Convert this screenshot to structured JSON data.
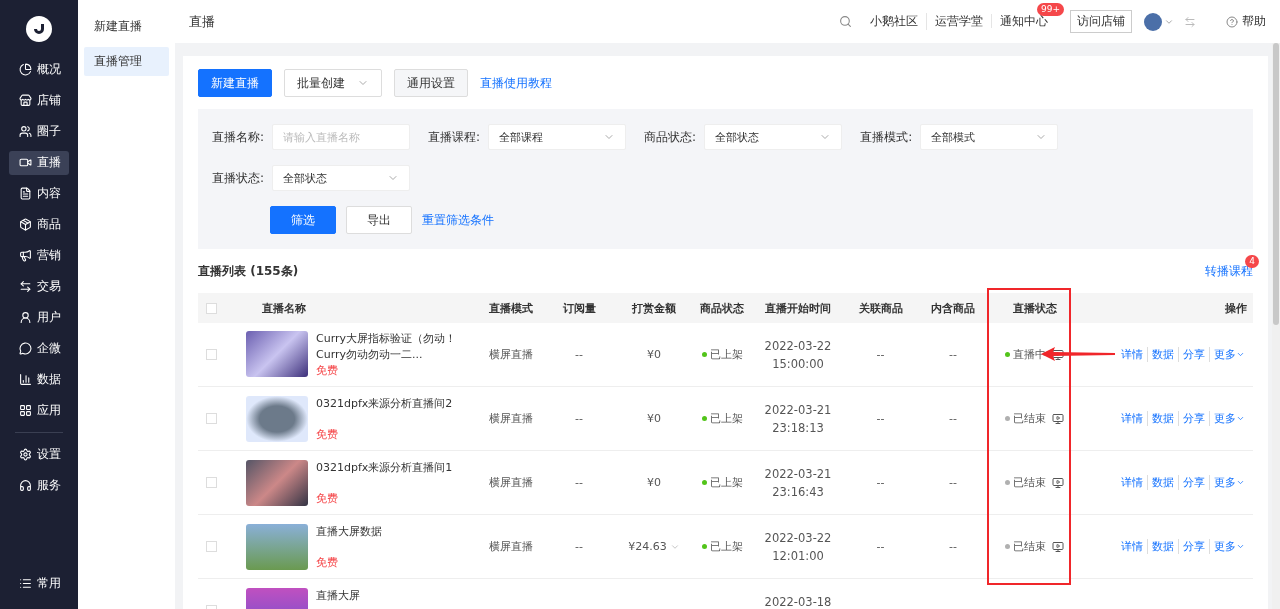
{
  "sidebar": {
    "items": [
      {
        "label": "概况",
        "selected": false
      },
      {
        "label": "店铺",
        "selected": false
      },
      {
        "label": "圈子",
        "selected": false
      },
      {
        "label": "直播",
        "selected": true
      },
      {
        "label": "内容",
        "selected": false
      },
      {
        "label": "商品",
        "selected": false
      },
      {
        "label": "营销",
        "selected": false
      },
      {
        "label": "交易",
        "selected": false
      },
      {
        "label": "用户",
        "selected": false
      },
      {
        "label": "企微",
        "selected": false
      },
      {
        "label": "数据",
        "selected": false
      },
      {
        "label": "应用",
        "selected": false
      }
    ],
    "bottom_items": [
      {
        "label": "设置",
        "selected": false
      },
      {
        "label": "服务",
        "selected": false
      }
    ],
    "footer": {
      "label": "常用"
    }
  },
  "subnav": {
    "items": [
      {
        "label": "新建直播",
        "selected": false
      },
      {
        "label": "直播管理",
        "selected": true
      }
    ]
  },
  "header": {
    "title": "直播",
    "links": [
      "小鹅社区",
      "运营学堂"
    ],
    "notifications": {
      "label": "通知中心",
      "badge": "99+"
    },
    "visit_button": "访问店铺",
    "help": "帮助"
  },
  "toolbar": {
    "primary": "新建直播",
    "batch": "批量创建",
    "settings": "通用设置",
    "tutorial": "直播使用教程"
  },
  "filters": [
    {
      "label": "直播名称:",
      "kind": "input",
      "placeholder": "请输入直播名称"
    },
    {
      "label": "直播课程:",
      "kind": "select",
      "value": "全部课程"
    },
    {
      "label": "商品状态:",
      "kind": "select",
      "value": "全部状态"
    },
    {
      "label": "直播模式:",
      "kind": "select",
      "value": "全部模式"
    },
    {
      "label": "直播状态:",
      "kind": "select",
      "value": "全部状态"
    }
  ],
  "filter_actions": {
    "filter": "筛选",
    "export": "导出",
    "reset": "重置筛选条件"
  },
  "list": {
    "title": "直播列表 (155条)",
    "relay": {
      "label": "转播课程",
      "badge": "4"
    },
    "select_all_checked": false,
    "columns": [
      "直播名称",
      "直播模式",
      "订阅量",
      "打赏金额",
      "商品状态",
      "直播开始时间",
      "关联商品",
      "内含商品",
      "直播状态",
      "操作"
    ],
    "rows": [
      {
        "name": "Curry大屏指标验证（勿动！Curry勿动勿动一二...",
        "price": "免费",
        "mode": "横屏直播",
        "subs": "--",
        "reward": "¥0",
        "reward_more": false,
        "goods": {
          "label": "已上架",
          "color": "#52c41a"
        },
        "date": "2022-03-22",
        "time": "15:00:00",
        "related": "--",
        "contained": "--",
        "status": {
          "label": "直播中",
          "color": "#52c41a"
        },
        "actions": [
          "详情",
          "数据",
          "分享",
          "更多"
        ],
        "checked": false
      },
      {
        "name": "0321dpfx来源分析直播间2",
        "price": "免费",
        "mode": "横屏直播",
        "subs": "--",
        "reward": "¥0",
        "reward_more": false,
        "goods": {
          "label": "已上架",
          "color": "#52c41a"
        },
        "date": "2022-03-21",
        "time": "23:18:13",
        "related": "--",
        "contained": "--",
        "status": {
          "label": "已结束",
          "color": "#b0b0b0"
        },
        "actions": [
          "详情",
          "数据",
          "分享",
          "更多"
        ],
        "checked": false
      },
      {
        "name": "0321dpfx来源分析直播间1",
        "price": "免费",
        "mode": "横屏直播",
        "subs": "--",
        "reward": "¥0",
        "reward_more": false,
        "goods": {
          "label": "已上架",
          "color": "#52c41a"
        },
        "date": "2022-03-21",
        "time": "23:16:43",
        "related": "--",
        "contained": "--",
        "status": {
          "label": "已结束",
          "color": "#b0b0b0"
        },
        "actions": [
          "详情",
          "数据",
          "分享",
          "更多"
        ],
        "checked": false
      },
      {
        "name": "直播大屏数据",
        "price": "免费",
        "mode": "横屏直播",
        "subs": "--",
        "reward": "¥24.63",
        "reward_more": true,
        "goods": {
          "label": "已上架",
          "color": "#52c41a"
        },
        "date": "2022-03-22",
        "time": "12:01:00",
        "related": "--",
        "contained": "--",
        "status": {
          "label": "已结束",
          "color": "#b0b0b0"
        },
        "actions": [
          "详情",
          "数据",
          "分享",
          "更多"
        ],
        "checked": false
      },
      {
        "name": "直播大屏",
        "date": "2022-03-18",
        "checked": false
      }
    ]
  }
}
